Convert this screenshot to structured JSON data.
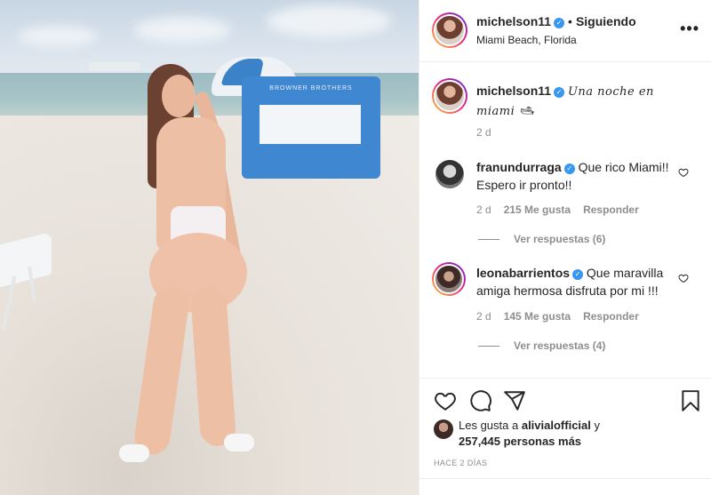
{
  "header": {
    "username": "michelson11",
    "follow_status": "Siguiendo",
    "location": "Miami Beach, Florida",
    "more_icon": "more-horizontal-icon"
  },
  "caption": {
    "username": "michelson11",
    "text": "Una noche en miami 🛥",
    "time": "2 d"
  },
  "comments": [
    {
      "username": "franundurraga",
      "text": "Que rico Miami!! Espero ir pronto!!",
      "time": "2 d",
      "likes": "215 Me gusta",
      "reply_label": "Responder",
      "view_replies": "Ver respuestas (6)"
    },
    {
      "username": "leonabarrientos",
      "text": "Que maravilla amiga hermosa disfruta por mi !!!",
      "time": "2 d",
      "likes": "145 Me gusta",
      "reply_label": "Responder",
      "view_replies": "Ver respuestas (4)"
    }
  ],
  "actions": {
    "icons": [
      "heart-icon",
      "comment-icon",
      "share-icon",
      "bookmark-icon"
    ]
  },
  "likes_summary": {
    "prefix": "Les gusta a",
    "user": "alivialofficial",
    "conjunction": "y",
    "count": "257,445 personas más"
  },
  "timestamp": "HACE 2 DÍAS",
  "photo": {
    "cabana_text": "BROWNER BROTHERS"
  },
  "colors": {
    "verified": "#3897f0",
    "muted": "#8e8e8e",
    "text": "#262626"
  }
}
